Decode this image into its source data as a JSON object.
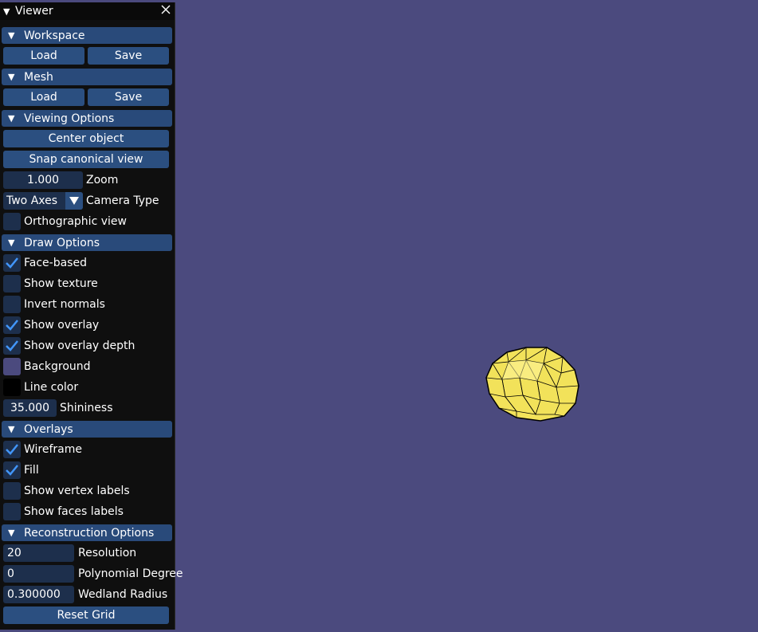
{
  "panel": {
    "title": "Viewer"
  },
  "workspace": {
    "header": "Workspace",
    "load": "Load",
    "save": "Save"
  },
  "mesh": {
    "header": "Mesh",
    "load": "Load",
    "save": "Save"
  },
  "viewing": {
    "header": "Viewing Options",
    "center_object": "Center object",
    "snap_view": "Snap canonical view",
    "zoom_value": "1.000",
    "zoom_label": "Zoom",
    "camera_value": "Two Axes",
    "camera_label": "Camera Type",
    "ortho_label": "Orthographic view",
    "ortho_checked": false
  },
  "draw": {
    "header": "Draw Options",
    "face_based": "Face-based",
    "face_based_checked": true,
    "show_texture": "Show texture",
    "show_texture_checked": false,
    "invert_normals": "Invert normals",
    "invert_normals_checked": false,
    "show_overlay": "Show overlay",
    "show_overlay_checked": true,
    "show_overlay_depth": "Show overlay depth",
    "show_overlay_depth_checked": true,
    "background": "Background",
    "background_color": "#4b4a7e",
    "line_color": "Line color",
    "line_color_value": "#000000",
    "shininess_value": "35.000",
    "shininess_label": "Shininess"
  },
  "overlays": {
    "header": "Overlays",
    "wireframe": "Wireframe",
    "wireframe_checked": true,
    "fill": "Fill",
    "fill_checked": true,
    "vertex_labels": "Show vertex labels",
    "vertex_labels_checked": false,
    "face_labels": "Show faces labels",
    "face_labels_checked": false
  },
  "reconstruction": {
    "header": "Reconstruction Options",
    "resolution_value": "20",
    "resolution_label": "Resolution",
    "degree_value": "0",
    "degree_label": "Polynomial Degree",
    "radius_value": "0.300000",
    "radius_label": "Wedland Radius",
    "reset": "Reset Grid"
  },
  "colors": {
    "accent": "#2b4f80",
    "header": "#294a7a",
    "frame": "#1d2f4c",
    "check": "#4296fa",
    "mesh_fill": "#f2e25a"
  }
}
